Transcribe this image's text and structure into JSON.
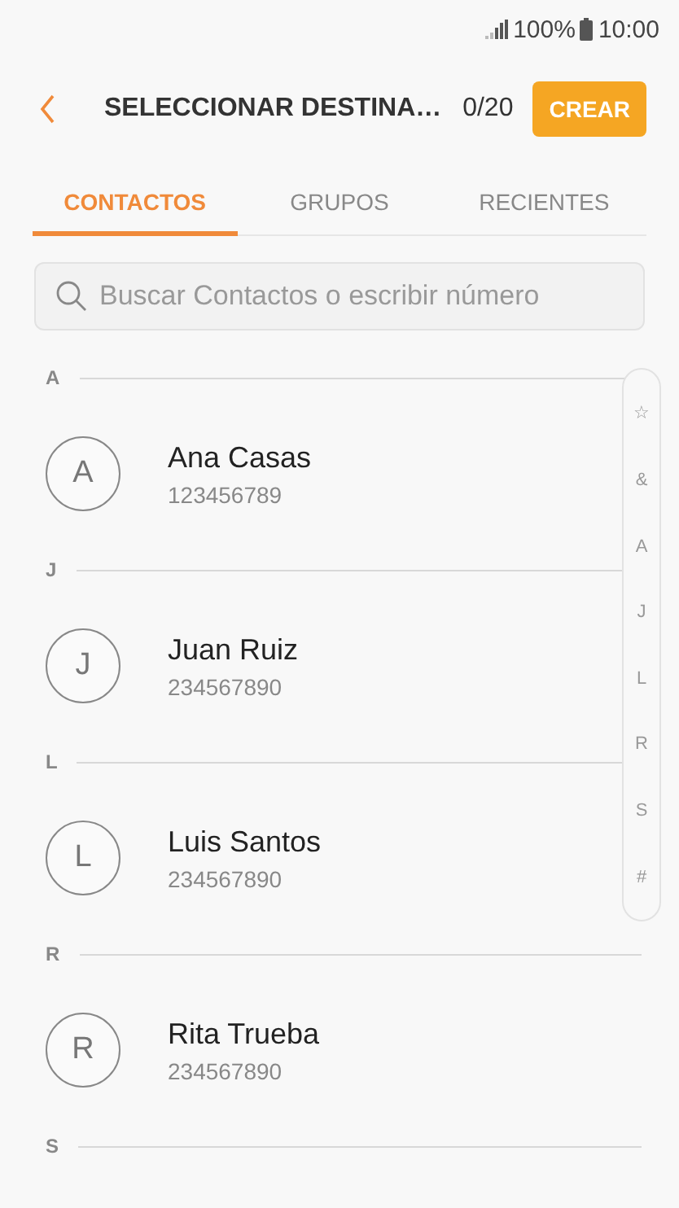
{
  "status_bar": {
    "battery": "100%",
    "time": "10:00"
  },
  "header": {
    "title": "SELECCIONAR DESTINA…",
    "counter": "0/20",
    "action": "CREAR"
  },
  "tabs": [
    {
      "label": "CONTACTOS",
      "selected": true
    },
    {
      "label": "GRUPOS",
      "selected": false
    },
    {
      "label": "RECIENTES",
      "selected": false
    }
  ],
  "search": {
    "placeholder": "Buscar Contactos o escribir número"
  },
  "sections": [
    {
      "letter": "A",
      "contacts": [
        {
          "initial": "A",
          "name": "Ana Casas",
          "number": "123456789"
        }
      ]
    },
    {
      "letter": "J",
      "contacts": [
        {
          "initial": "J",
          "name": "Juan Ruiz",
          "number": "234567890"
        }
      ]
    },
    {
      "letter": "L",
      "contacts": [
        {
          "initial": "L",
          "name": "Luis Santos",
          "number": "234567890"
        }
      ]
    },
    {
      "letter": "R",
      "contacts": [
        {
          "initial": "R",
          "name": "Rita Trueba",
          "number": "234567890"
        }
      ]
    },
    {
      "letter": "S"
    }
  ],
  "index": [
    "☆",
    "&",
    "A",
    "J",
    "L",
    "R",
    "S",
    "#"
  ]
}
